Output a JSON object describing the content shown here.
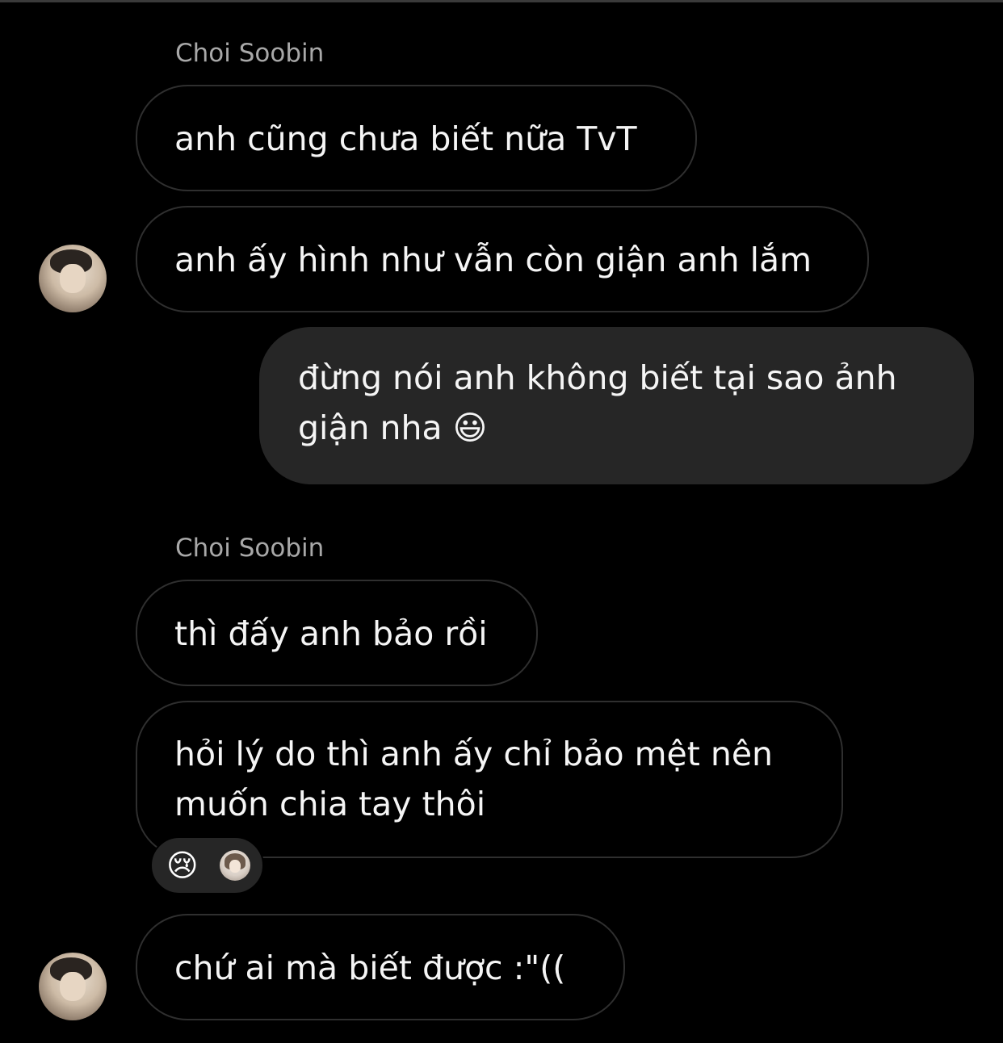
{
  "chat": {
    "group1": {
      "sender": "Choi Soobin",
      "messages": [
        "anh cũng chưa biết nữa TvT",
        "anh ấy hình như vẫn còn giận anh lắm"
      ]
    },
    "outgoing": {
      "line1": "đừng nói anh không biết tại sao ảnh",
      "line2": "giận nha 😃"
    },
    "group2": {
      "sender": "Choi Soobin",
      "messages": [
        "thì đấy anh bảo rồi",
        "chứ ai mà biết được :\"(("
      ],
      "long_message": {
        "line1": "hỏi lý do thì anh ấy chỉ bảo mệt nên",
        "line2": "muốn chia tay thôi"
      },
      "reaction": {
        "emoji": "😢",
        "icon": "crying-face-emoji"
      }
    }
  }
}
